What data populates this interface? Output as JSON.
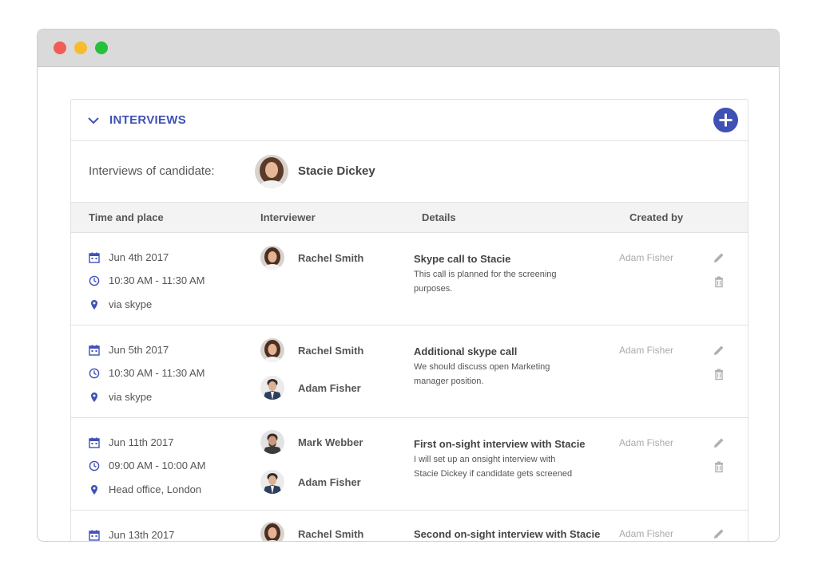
{
  "panel": {
    "title": "INTERVIEWS",
    "candidate_label": "Interviews of candidate:",
    "candidate_name": "Stacie Dickey"
  },
  "table": {
    "headers": [
      "Time and place",
      "Interviewer",
      "Details",
      "Created by"
    ],
    "rows": [
      {
        "date": "Jun 4th 2017",
        "time": "10:30 AM - 11:30 AM",
        "place": "via skype",
        "interviewers": [
          "Rachel Smith"
        ],
        "detail_title": "Skype call to Stacie",
        "detail_desc": "This call is planned for the screening purposes.",
        "created_by": "Adam Fisher"
      },
      {
        "date": "Jun 5th 2017",
        "time": "10:30 AM - 11:30 AM",
        "place": "via skype",
        "interviewers": [
          "Rachel Smith",
          "Adam Fisher"
        ],
        "detail_title": "Additional skype call",
        "detail_desc": "We should discuss open Marketing manager position.",
        "created_by": "Adam Fisher"
      },
      {
        "date": "Jun 11th 2017",
        "time": "09:00 AM - 10:00 AM",
        "place": "Head office, London",
        "interviewers": [
          "Mark Webber",
          "Adam Fisher"
        ],
        "detail_title": "First on-sight interview with Stacie",
        "detail_desc": "I will set up an onsight interview with Stacie Dickey if candidate gets screened",
        "created_by": "Adam Fisher"
      },
      {
        "date": "Jun 13th 2017",
        "interviewers": [
          "Rachel Smith"
        ],
        "detail_title": "Second on-sight interview with Stacie",
        "created_by": "Adam Fisher"
      }
    ]
  },
  "icons": {
    "chevron": "chevron-down-icon",
    "add": "plus-icon",
    "date": "calendar-icon",
    "time": "clock-icon",
    "place": "map-pin-icon",
    "edit": "pencil-icon",
    "delete": "trash-icon"
  },
  "colors": {
    "accent": "#3f51b5",
    "header_bg": "#f3f3f3",
    "muted": "#aaaaaa"
  }
}
